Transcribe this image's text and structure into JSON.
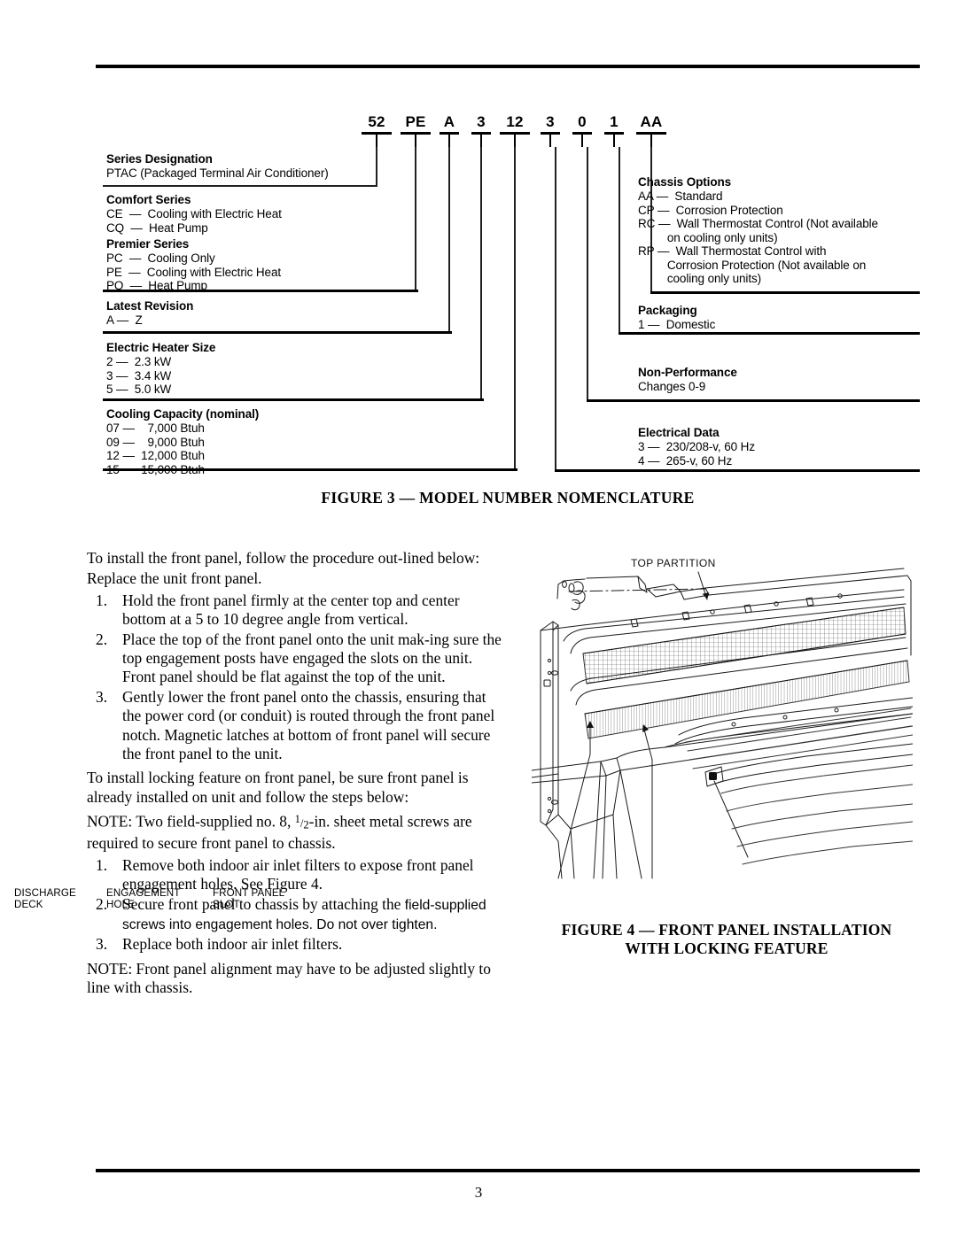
{
  "page": {
    "number": "3"
  },
  "figure3": {
    "caption": "FIGURE 3 — MODEL NUMBER NOMENCLATURE",
    "model_number_segments": [
      "52",
      "PE",
      "A",
      "3",
      "12",
      "3",
      "0",
      "1",
      "AA"
    ],
    "left_labels": [
      {
        "title": "Series Designation",
        "lines": [
          "PTAC (Packaged Terminal Air Conditioner)"
        ]
      },
      {
        "title": "Comfort Series",
        "lines": [
          "CE  —  Cooling with Electric Heat",
          "CQ  —  Heat Pump"
        ]
      },
      {
        "title": "Premier Series",
        "lines": [
          "PC  —  Cooling Only",
          "PE  —  Cooling with Electric Heat",
          "PQ  —  Heat Pump"
        ]
      },
      {
        "title": "Latest Revision",
        "lines": [
          "A —  Z"
        ]
      },
      {
        "title": "Electric Heater Size",
        "lines": [
          "2 —  2.3 kW",
          "3 —  3.4 kW",
          "5 —  5.0 kW"
        ]
      },
      {
        "title": "Cooling Capacity (nominal)",
        "lines": [
          "07 —    7,000 Btuh",
          "09 —    9,000 Btuh",
          "12 —  12,000 Btuh",
          "15 —  15,000 Btuh"
        ]
      }
    ],
    "right_labels": [
      {
        "title": "Chassis Options",
        "lines": [
          "AA —  Standard",
          "CP —  Corrosion Protection",
          "RC —  Wall Thermostat Control (Not available",
          "         on cooling only units)",
          "RP —  Wall Thermostat Control with",
          "         Corrosion Protection (Not available on",
          "         cooling only units)"
        ]
      },
      {
        "title": "Packaging",
        "lines": [
          "1 —  Domestic"
        ]
      },
      {
        "title": "Non-Performance",
        "lines": [
          "Changes 0-9"
        ]
      },
      {
        "title": "Electrical Data",
        "lines": [
          "3 —  230/208-v, 60 Hz",
          "4 —  265-v, 60 Hz"
        ]
      }
    ]
  },
  "body": {
    "intro1": "To install the front panel, follow the procedure out-lined below:",
    "intro2": "Replace the unit front panel.",
    "steps1": [
      {
        "num": "1.",
        "text": "Hold the front panel firmly at the center top and center bottom at a 5 to 10 degree angle from vertical."
      },
      {
        "num": "2.",
        "text": "Place the top of the front panel onto the unit mak-ing sure the top engagement posts have engaged the slots on the unit. Front panel should be flat against the top of the unit."
      },
      {
        "num": "3.",
        "text": "Gently lower the front panel onto the chassis, ensuring that the power cord (or conduit) is routed through the front panel notch. Magnetic latches at bottom of front panel will secure the front panel to the unit."
      }
    ],
    "intro3": "To install locking feature on front panel, be sure front panel is already installed on unit and follow the steps below:",
    "note1_a": "NOTE: Two field-supplied no. 8, ",
    "note1_frac_num": "1",
    "note1_frac_den": "2",
    "note1_b": "-in. sheet metal screws are required to secure front panel to chassis.",
    "steps2": [
      {
        "num": "1.",
        "text": "Remove both indoor air inlet filters to expose front panel engagement holes. See Figure 4."
      },
      {
        "num": "2.",
        "text_serif": "Secure front panel to chassis by attaching the ",
        "text_sans": "field-supplied screws into engagement holes. Do not over tighten."
      },
      {
        "num": "3.",
        "text": "Replace both indoor air inlet filters."
      }
    ],
    "note2": "NOTE: Front panel alignment may have to be adjusted slightly to line with chassis."
  },
  "figure4": {
    "caption_line1": "FIGURE 4 — FRONT PANEL INSTALLATION",
    "caption_line2": "WITH LOCKING FEATURE",
    "top_label": "TOP PARTITION",
    "callouts": [
      {
        "line1": "DISCHARGE",
        "line2": "DECK"
      },
      {
        "line1": "ENGAGEMENT",
        "line2": "HOLE"
      },
      {
        "line1": "FRONT PANEL",
        "line2": "SLOT"
      }
    ]
  }
}
